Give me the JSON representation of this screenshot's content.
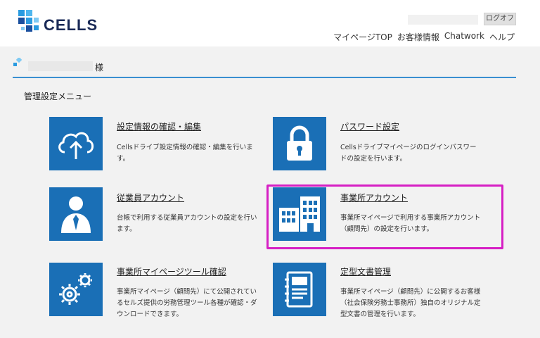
{
  "header": {
    "logo_text": "CELLS",
    "logout_label": "ログオフ",
    "nav": [
      {
        "label": "マイページTOP"
      },
      {
        "label": "お客様情報"
      },
      {
        "label": "Chatwork"
      },
      {
        "label": "ヘルプ"
      }
    ]
  },
  "user": {
    "honorific": "様"
  },
  "section": {
    "title": "管理設定メニュー"
  },
  "cards": [
    {
      "title": "設定情報の確認・編集",
      "desc": "Cellsドライブ設定情報の確認・編集を行います。",
      "icon": "cloud-upload-icon"
    },
    {
      "title": "パスワード設定",
      "desc": "Cellsドライブマイページのログインパスワードの設定を行います。",
      "icon": "lock-icon"
    },
    {
      "title": "従業員アカウント",
      "desc": "台帳で利用する従業員アカウントの設定を行います。",
      "icon": "employee-icon"
    },
    {
      "title": "事業所アカウント",
      "desc": "事業所マイページで利用する事業所アカウント（顧問先）の設定を行います。",
      "icon": "office-building-icon"
    },
    {
      "title": "事業所マイページツール確認",
      "desc": "事業所マイページ（顧問先）にて公開されているセルズ提供の労務管理ツール各種が確認・ダウンロードできます。",
      "icon": "gears-icon"
    },
    {
      "title": "定型文書管理",
      "desc": "事業所マイページ（顧問先）に公開するお客様（社会保険労務士事務所）独自のオリジナル定型文書の管理を行います。",
      "icon": "document-icon"
    }
  ],
  "colors": {
    "accent": "#1a6fb6",
    "rule": "#3a8fd1",
    "highlight": "#d61fc4",
    "background": "#f2f2f2"
  }
}
